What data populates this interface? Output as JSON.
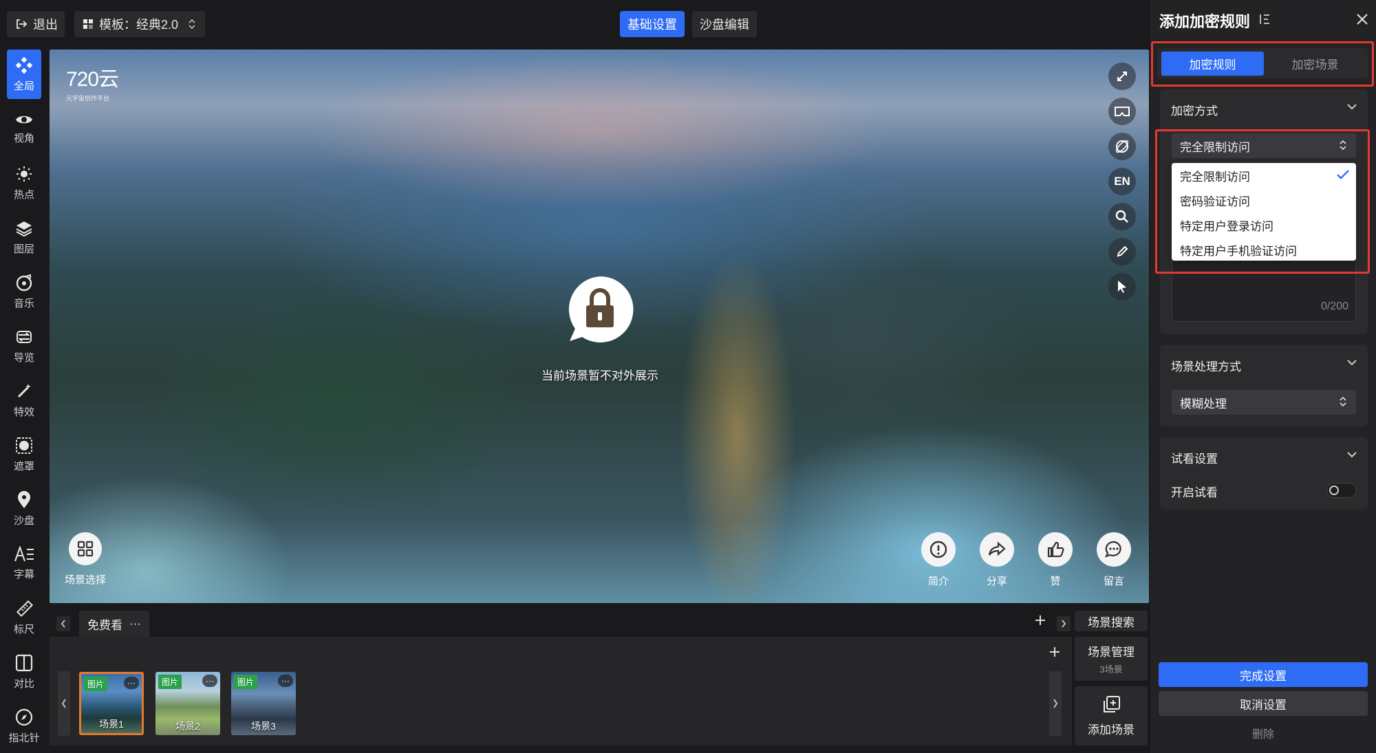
{
  "topbar": {
    "exit_label": "退出",
    "template_label": "模板：经典2.0",
    "tab_basic": "基础设置",
    "tab_sandbox": "沙盘编辑"
  },
  "sidebar": {
    "items": [
      {
        "label": "全局",
        "icon": "global-icon"
      },
      {
        "label": "视角",
        "icon": "eye-icon"
      },
      {
        "label": "热点",
        "icon": "hotspot-icon"
      },
      {
        "label": "图层",
        "icon": "layers-icon"
      },
      {
        "label": "音乐",
        "icon": "music-icon"
      },
      {
        "label": "导览",
        "icon": "tour-icon"
      },
      {
        "label": "特效",
        "icon": "magic-wand-icon"
      },
      {
        "label": "遮罩",
        "icon": "mask-icon"
      },
      {
        "label": "沙盘",
        "icon": "map-pin-icon"
      },
      {
        "label": "字幕",
        "icon": "subtitle-icon"
      },
      {
        "label": "标尺",
        "icon": "ruler-icon"
      },
      {
        "label": "对比",
        "icon": "compare-icon"
      },
      {
        "label": "指北针",
        "icon": "compass-icon"
      }
    ]
  },
  "viewport": {
    "logo_text": "720云",
    "logo_sub": "元宇宙创作平台",
    "lock_message": "当前场景暂不对外展示",
    "scene_select_label": "场景选择",
    "right_tools": [
      "fullscreen-icon",
      "vr-glasses-icon",
      "gyroscope-icon",
      "EN",
      "search-icon",
      "edit-pencil-icon",
      "pointer-icon"
    ],
    "actions": [
      {
        "label": "简介",
        "icon": "info-icon"
      },
      {
        "label": "分享",
        "icon": "share-icon"
      },
      {
        "label": "赞",
        "icon": "thumbs-up-icon"
      },
      {
        "label": "留言",
        "icon": "comment-icon"
      }
    ]
  },
  "scenes": {
    "group_tab": "免费看",
    "group_more": "···",
    "search_label": "场景搜索",
    "manage_label": "场景管理",
    "manage_count": "3场景",
    "add_label": "添加场景",
    "items": [
      {
        "tag": "图片",
        "name": "场景1",
        "more": "···"
      },
      {
        "tag": "图片",
        "name": "场景2",
        "more": "···"
      },
      {
        "tag": "图片",
        "name": "场景3",
        "more": "···"
      }
    ]
  },
  "panel": {
    "title": "添加加密规则",
    "tab_rules": "加密规则",
    "tab_scenes": "加密场景",
    "method_title": "加密方式",
    "method_value": "完全限制访问",
    "method_options": [
      "完全限制访问",
      "密码验证访问",
      "特定用户登录访问",
      "特定用户手机验证访问"
    ],
    "textarea_count": "0/200",
    "process_title": "场景处理方式",
    "process_value": "模糊处理",
    "trial_title": "试看设置",
    "trial_toggle_label": "开启试看",
    "trial_enabled": false,
    "finish_label": "完成设置",
    "cancel_label": "取消设置",
    "delete_label": "删除"
  },
  "colors": {
    "accent": "#2f6cf6",
    "highlight_box": "#e53935",
    "panel_bg": "#232325",
    "selected_thumb_border": "#e8792b"
  }
}
